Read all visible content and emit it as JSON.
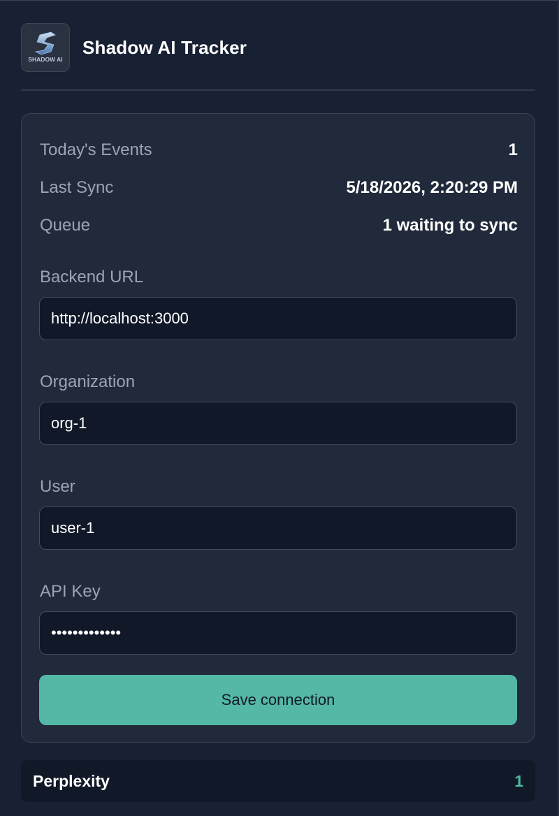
{
  "app": {
    "title": "Shadow AI Tracker",
    "logo_text": "SHADOW AI",
    "logo_icon": "shadow-ai-logo-icon"
  },
  "stats": [
    {
      "label": "Today's Events",
      "value": "1"
    },
    {
      "label": "Last Sync",
      "value": "5/18/2026, 2:20:29 PM"
    },
    {
      "label": "Queue",
      "value": "1 waiting to sync"
    }
  ],
  "fields": {
    "backend_url": {
      "label": "Backend URL",
      "value": "http://localhost:3000"
    },
    "organization": {
      "label": "Organization",
      "value": "org-1"
    },
    "user": {
      "label": "User",
      "value": "user-1"
    },
    "api_key": {
      "label": "API Key",
      "value": "•••••••••••••"
    }
  },
  "save_button_label": "Save connection",
  "tools": [
    {
      "name": "Perplexity",
      "count": "1"
    }
  ],
  "colors": {
    "background": "#182033",
    "card": "#212a3a",
    "input": "#111828",
    "accent": "#55b7a6",
    "accent_text": "#4fb8a5"
  }
}
